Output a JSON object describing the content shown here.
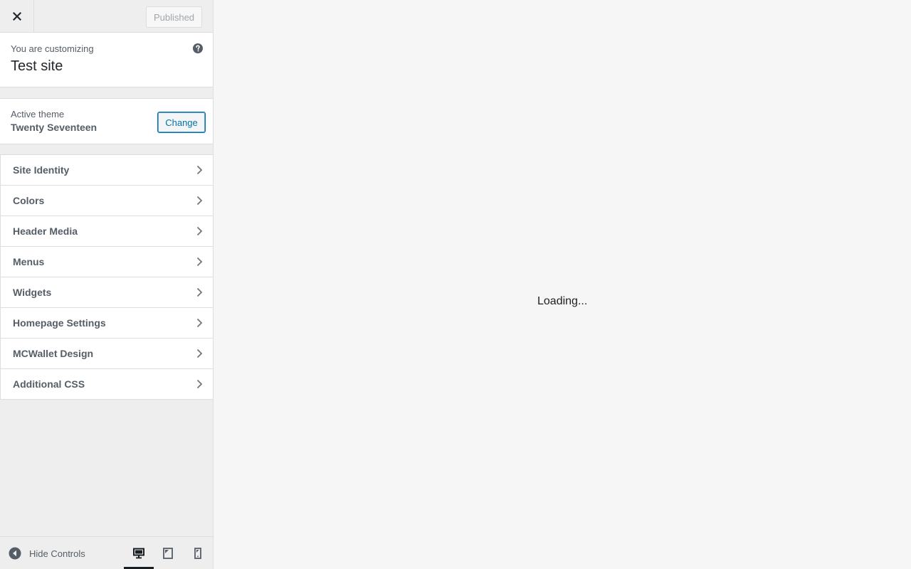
{
  "topbar": {
    "close_icon": "close-icon",
    "publish_label": "Published"
  },
  "info": {
    "customizing_label": "You are customizing",
    "site_title": "Test site",
    "help_icon": "help-icon"
  },
  "theme": {
    "label": "Active theme",
    "name": "Twenty Seventeen",
    "change_label": "Change"
  },
  "sections": [
    {
      "label": "Site Identity"
    },
    {
      "label": "Colors"
    },
    {
      "label": "Header Media"
    },
    {
      "label": "Menus"
    },
    {
      "label": "Widgets"
    },
    {
      "label": "Homepage Settings"
    },
    {
      "label": "MCWallet Design"
    },
    {
      "label": "Additional CSS"
    }
  ],
  "footer": {
    "hide_controls_label": "Hide Controls",
    "hide_controls_icon": "collapse-arrow-icon",
    "devices": [
      "desktop",
      "tablet",
      "mobile"
    ],
    "active_device": "desktop"
  },
  "preview": {
    "loading_text": "Loading..."
  },
  "colors": {
    "accent": "#0073aa",
    "sidebar_bg": "#eeeeee",
    "panel_bg": "#ffffff",
    "text": "#555d66"
  }
}
